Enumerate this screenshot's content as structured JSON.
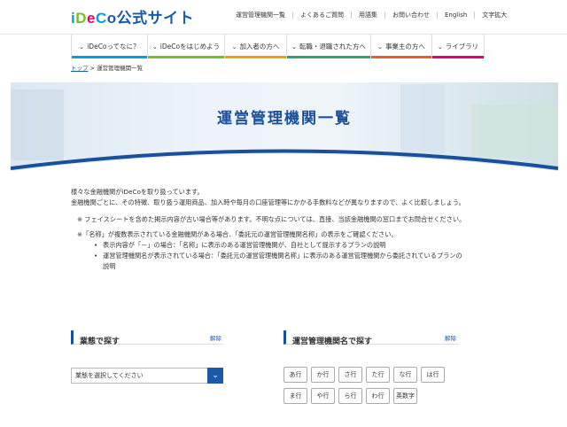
{
  "header": {
    "logo": {
      "p1": "i",
      "p2": "D",
      "p3": "e",
      "p4": "C",
      "p5": "o",
      "p6": "公式サイト"
    },
    "links": [
      "運営管理機関一覧",
      "よくあるご質問",
      "用語集",
      "お問い合わせ",
      "English",
      "文字拡大"
    ]
  },
  "nav": {
    "items": [
      {
        "label": "iDeCoってなに？",
        "color": "#00a0e0"
      },
      {
        "label": "iDeCoをはじめよう",
        "color": "#7dbb2c"
      },
      {
        "label": "加入者の方へ",
        "color": "#e8a400"
      },
      {
        "label": "転職・退職された方へ",
        "color": "#2fa36b"
      },
      {
        "label": "事業主の方へ",
        "color": "#e95d2b"
      },
      {
        "label": "ライブラリ",
        "color": "#e6007e"
      }
    ]
  },
  "breadcrumb": {
    "home": "トップ",
    "sep": " > ",
    "current": "運営管理機関一覧"
  },
  "hero": {
    "title": "運営管理機関一覧"
  },
  "content": {
    "intro1": "様々な金融機関がiDeCoを取り扱っています。",
    "intro2": "金融機関ごとに、その特徴、取り扱う運用商品、加入時や毎月の口座管理等にかかる手数料などが異なりますので、よく比較しましょう。",
    "note1": "※ フェイスシートを含めた掲示内容が古い場合等があります。不明な点については、直接、当該金融機関の窓口までお問合せください。",
    "note2": "※「名称」が複数表示されている金融機関がある場合、「委託元の運営管理機関名称」の表示をご確認ください。",
    "bullet1": "表示内容が「－」の場合：「名称」に表示のある運営管理機関が、自社として提示するプランの説明",
    "bullet2a": "運営管理機関名が表示されている場合：「委託元の運営管理機関名称」に表示のある運営管理機関から委託されているプランの",
    "bullet2b": "説明"
  },
  "search_type": {
    "title": "業態で探す",
    "clear": "解除",
    "select_value": "業態を選択してください"
  },
  "search_name": {
    "title": "運営管理機関名で探す",
    "clear": "解除",
    "kana": [
      "あ行",
      "か行",
      "さ行",
      "た行",
      "な行",
      "は行",
      "ま行",
      "や行",
      "ら行",
      "わ行",
      "英数字"
    ]
  }
}
